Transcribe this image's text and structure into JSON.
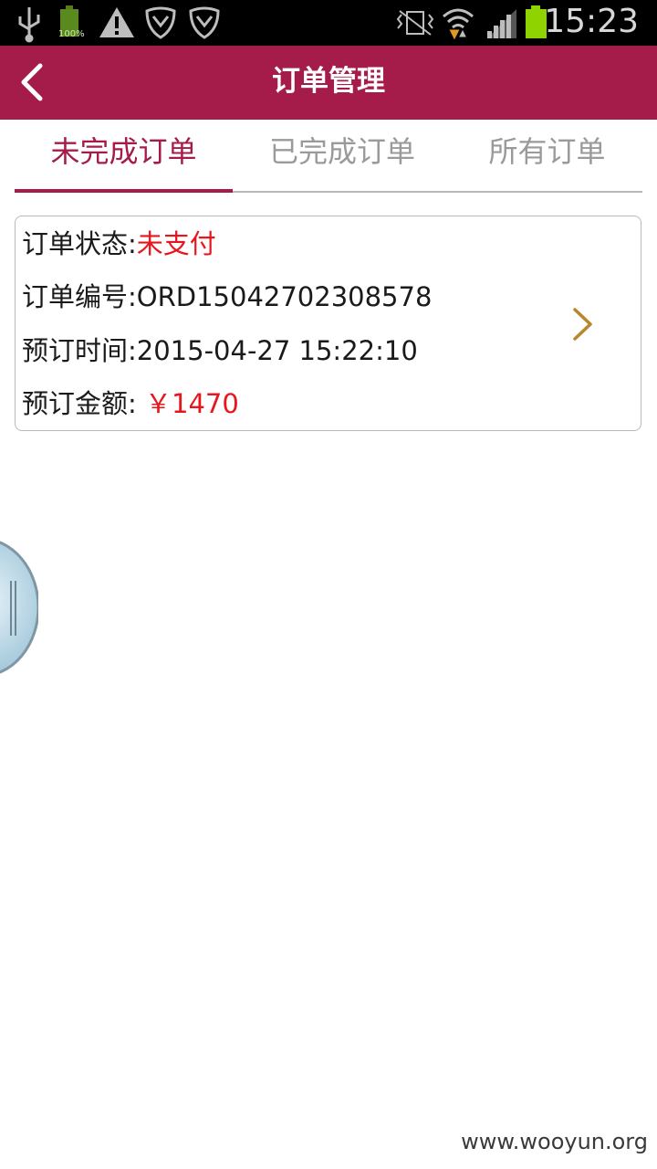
{
  "status_bar": {
    "battery_percent": "100%",
    "time": "15:23",
    "icons": [
      "usb-icon",
      "battery-small-icon",
      "warning-icon",
      "shield-icon",
      "shield-icon",
      "vibrate-icon",
      "wifi-icon",
      "signal-icon",
      "battery-icon"
    ]
  },
  "header": {
    "title": "订单管理",
    "background": "#a51c4b"
  },
  "tabs": [
    {
      "label": "未完成订单",
      "active": true
    },
    {
      "label": "已完成订单",
      "active": false
    },
    {
      "label": "所有订单",
      "active": false
    }
  ],
  "order": {
    "status_label": "订单状态:",
    "status_value": "未支付",
    "number_label": "订单编号:",
    "number_value": "ORD15042702308578",
    "time_label": "预订时间:",
    "time_value": "2015-04-27 15:22:10",
    "amount_label": "预订金额:",
    "amount_value": "￥1470"
  },
  "watermark": "www.wooyun.org",
  "colors": {
    "accent": "#a51c4b",
    "alert_red": "#e8161c",
    "chevron": "#b8862c"
  }
}
